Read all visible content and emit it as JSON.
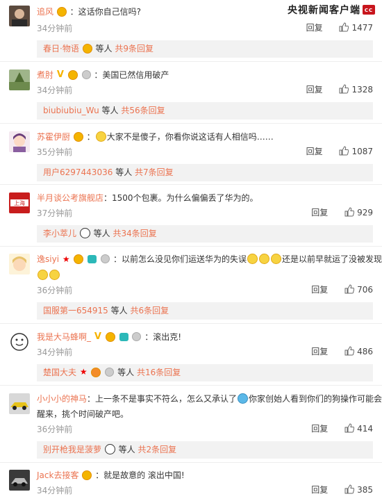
{
  "watermark": "央视新闻客户端",
  "reply_label": "回复",
  "others_label": "等人",
  "comments": [
    {
      "username": "追风",
      "content": "：这话你自己信吗?",
      "time": "34分钟前",
      "likes": "1477",
      "sub_user": "春日·物语",
      "sub_count": "共9条回复"
    },
    {
      "username": "煮肘",
      "content": "：美国已然信用破产",
      "time": "34分钟前",
      "likes": "1328",
      "sub_user": "biubiubiu_Wu",
      "sub_count": "共56条回复"
    },
    {
      "username": "苏霍伊厨",
      "content": "大家不是傻子，你看你说这话有人相信吗……",
      "time": "35分钟前",
      "likes": "1087",
      "sub_user": "用户6297443036",
      "sub_count": "共7条回复"
    },
    {
      "username": "半月谈公考旗舰店",
      "content": "：1500个包裹。为什么偏偏丢了华为的。",
      "time": "37分钟前",
      "likes": "929",
      "sub_user": "李小萃儿",
      "sub_count": "共34条回复"
    },
    {
      "username": "逸siyi",
      "content_a": "：以前怎么没见你们运送华为的失误",
      "content_b": "还是以前早就运了没被发现",
      "time": "36分钟前",
      "likes": "706",
      "sub_user": "国服第一654915",
      "sub_count": "共6条回复"
    },
    {
      "username": "我是大马蜂啊_",
      "content": "：滚出克!",
      "time": "34分钟前",
      "likes": "486",
      "sub_user": "楚国大夫",
      "sub_count": "共16条回复"
    },
    {
      "username": "小小小的神马",
      "content_a": "：上一条不是事实不符么，怎么又承认了",
      "content_b": "你家创始人看到你们的狗操作可能会气",
      "content_c": "醒来，挑个时间破产吧。",
      "time": "36分钟前",
      "likes": "414",
      "sub_user": "别开枪我是菠萝",
      "sub_count": "共2条回复"
    },
    {
      "username": "Jack去接客",
      "content": "：就是故意的 滚出中国!",
      "time": "34分钟前",
      "likes": "385"
    }
  ]
}
